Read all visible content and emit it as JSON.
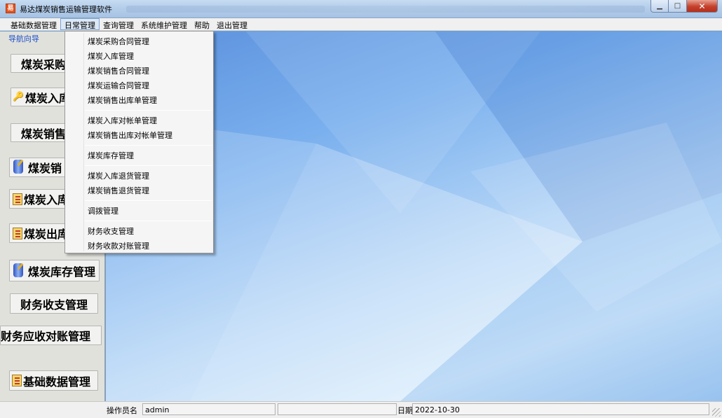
{
  "window": {
    "title": "易达煤炭销售运输管理软件",
    "app_icon_glyph": "易",
    "minimize_glyph": "▁",
    "maximize_glyph": "□",
    "close_glyph": "✕"
  },
  "menubar": {
    "items": [
      "基础数据管理",
      "日常管理",
      "查询管理",
      "系统维护管理",
      "帮助",
      "退出管理"
    ],
    "active": "日常管理"
  },
  "dropdown": {
    "groups": [
      [
        "煤炭采购合同管理",
        "煤炭入库管理",
        "煤炭销售合同管理",
        "煤炭运输合同管理",
        "煤炭销售出库单管理"
      ],
      [
        "煤炭入库对帐单管理",
        "煤炭销售出库对帐单管理"
      ],
      [
        "煤炭库存管理"
      ],
      [
        "煤炭入库退货管理",
        "煤炭销售退货管理"
      ],
      [
        "调拨管理"
      ],
      [
        "财务收支管理",
        "财务收款对账管理"
      ]
    ]
  },
  "leftpanel": {
    "header": "导航向导",
    "buttons": [
      {
        "label": "煤炭采购",
        "icon": "none"
      },
      {
        "label": "煤炭入库",
        "icon": "key-icon"
      },
      {
        "label": "煤炭销售",
        "icon": "none"
      },
      {
        "label": "煤炭销",
        "icon": "database-icon"
      },
      {
        "label": "煤炭入库",
        "icon": "document-icon"
      },
      {
        "label": "煤炭出库",
        "icon": "document-icon"
      },
      {
        "label": "煤炭库存管理",
        "icon": "database-icon"
      },
      {
        "label": "财务收支管理",
        "icon": "none"
      },
      {
        "label": "财务应收对账管理",
        "icon": "none"
      },
      {
        "label": "基础数据管理",
        "icon": "document-icon"
      }
    ]
  },
  "statusbar": {
    "operator_label": "操作员名",
    "operator_value": "admin",
    "date_label": "日期",
    "date_value": "2022-10-30"
  }
}
